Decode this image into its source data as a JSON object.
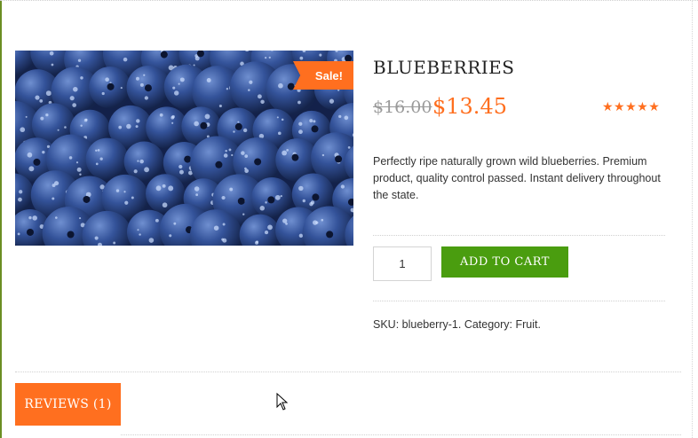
{
  "product": {
    "title": "BLUEBERRIES",
    "sale_badge": "Sale!",
    "price_old": "$16.00",
    "price_new": "$13.45",
    "rating_stars": "★★★★★",
    "rating_fraction": 1.0,
    "description": "Perfectly ripe naturally grown wild blueberries. Premium product,  quality control passed. Instant delivery throughout the state.",
    "quantity": "1",
    "add_to_cart_label": "ADD TO CART",
    "meta": "SKU: blueberry-1. Category: Fruit."
  },
  "tabs": {
    "reviews_label": "REVIEWS (1)"
  },
  "colors": {
    "accent": "#ff6f1f",
    "cart_button": "#4a9d0f"
  }
}
